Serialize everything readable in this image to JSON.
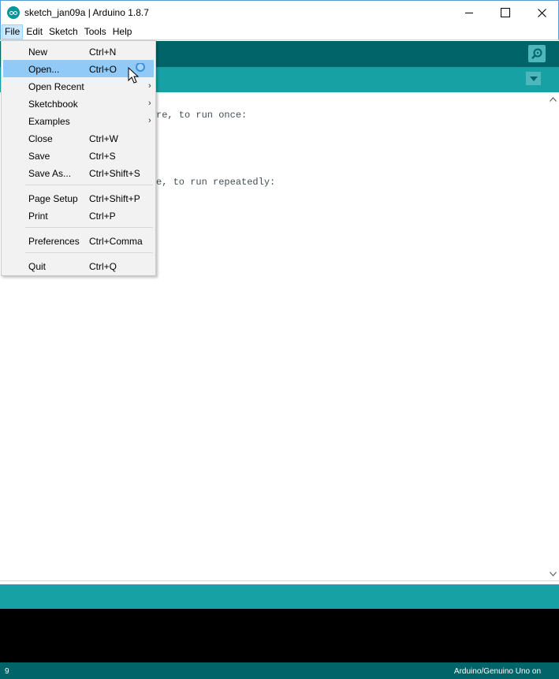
{
  "window": {
    "title": "sketch_jan09a | Arduino 1.8.7",
    "minimize_icon": "minimize-icon",
    "maximize_icon": "maximize-icon",
    "close_icon": "close-icon"
  },
  "menubar": {
    "items": [
      "File",
      "Edit",
      "Sketch",
      "Tools",
      "Help"
    ],
    "active": "File"
  },
  "toolbar": {
    "serial_monitor_icon": "magnifier-icon"
  },
  "tabbar": {
    "menu_icon": "triangle-down-icon"
  },
  "editor": {
    "visible_lines": [
      "re, to run once:",
      "e, to run repeatedly:"
    ]
  },
  "file_menu": {
    "items": [
      {
        "label": "New",
        "shortcut": "Ctrl+N",
        "submenu": false
      },
      {
        "label": "Open...",
        "shortcut": "Ctrl+O",
        "submenu": false,
        "hovered": true
      },
      {
        "label": "Open Recent",
        "shortcut": "",
        "submenu": true
      },
      {
        "label": "Sketchbook",
        "shortcut": "",
        "submenu": true
      },
      {
        "label": "Examples",
        "shortcut": "",
        "submenu": true
      },
      {
        "label": "Close",
        "shortcut": "Ctrl+W",
        "submenu": false
      },
      {
        "label": "Save",
        "shortcut": "Ctrl+S",
        "submenu": false
      },
      {
        "label": "Save As...",
        "shortcut": "Ctrl+Shift+S",
        "submenu": false
      },
      {
        "label": "Page Setup",
        "shortcut": "Ctrl+Shift+P",
        "submenu": false
      },
      {
        "label": "Print",
        "shortcut": "Ctrl+P",
        "submenu": false
      },
      {
        "label": "Preferences",
        "shortcut": "Ctrl+Comma",
        "submenu": false
      },
      {
        "label": "Quit",
        "shortcut": "Ctrl+Q",
        "submenu": false
      }
    ],
    "submenu_arrow": "›"
  },
  "footer": {
    "line_number": "9",
    "board": "Arduino/Genuino Uno on"
  },
  "colors": {
    "toolbar": "#006468",
    "tabbar": "#17a1a5",
    "menu_hover": "#91c9f7",
    "console": "#000000"
  }
}
